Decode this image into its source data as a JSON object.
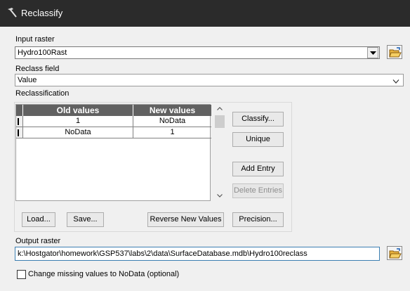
{
  "window": {
    "title": "Reclassify",
    "icon": "hammer-icon"
  },
  "input_raster": {
    "label": "Input raster",
    "value": "Hydro100Rast"
  },
  "reclass_field": {
    "label": "Reclass field",
    "value": "Value"
  },
  "reclassification": {
    "label": "Reclassification",
    "columns": [
      "Old values",
      "New values"
    ],
    "rows": [
      {
        "old": "1",
        "new": "NoData"
      },
      {
        "old": "NoData",
        "new": "1"
      }
    ],
    "buttons": {
      "classify": "Classify...",
      "unique": "Unique",
      "add_entry": "Add Entry",
      "delete_entries": "Delete Entries",
      "load": "Load...",
      "save": "Save...",
      "reverse": "Reverse New Values",
      "precision": "Precision..."
    }
  },
  "output_raster": {
    "label": "Output raster",
    "value": "k:\\Hostgator\\homework\\GSP537\\labs\\2\\data\\SurfaceDatabase.mdb\\Hydro100reclass"
  },
  "missing_values": {
    "label": "Change missing values to NoData (optional)",
    "checked": false
  },
  "colors": {
    "titlebar": "#2b2b2b",
    "grid_header": "#616161",
    "dialog_bg": "#f0f0f0"
  }
}
